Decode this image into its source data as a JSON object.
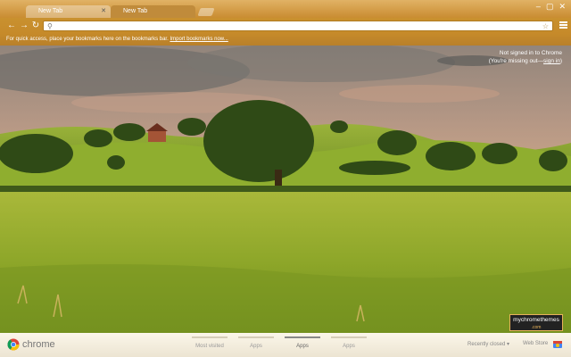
{
  "tabs": [
    {
      "label": "New Tab",
      "active": false
    },
    {
      "label": "New Tab",
      "active": true
    }
  ],
  "bookmarks_bar": {
    "message": "For quick access, place your bookmarks here on the bookmarks bar.",
    "link": "Import bookmarks now..."
  },
  "signin": {
    "line1": "Not signed in to Chrome",
    "line2_prefix": "(You're missing out—",
    "line2_link": "sign in",
    "line2_suffix": ")"
  },
  "bottom": {
    "logo_text": "chrome",
    "pages": [
      {
        "label": "Most visited",
        "active": false
      },
      {
        "label": "Apps",
        "active": false
      },
      {
        "label": "Apps",
        "active": true
      },
      {
        "label": "Apps",
        "active": false
      }
    ],
    "recently_closed": "Recently closed",
    "web_store": "Web Store"
  },
  "badge": {
    "line1": "mychromethemes",
    "line2": ".com"
  },
  "icons": {
    "back": "back-arrow-icon",
    "forward": "forward-arrow-icon",
    "reload": "reload-icon",
    "search": "search-icon",
    "star": "bookmark-star-icon",
    "menu": "menu-icon",
    "chrome": "chrome-logo-icon",
    "store": "web-store-icon"
  },
  "colors": {
    "frame": "#c9912f",
    "accent": "#e7b25a"
  }
}
